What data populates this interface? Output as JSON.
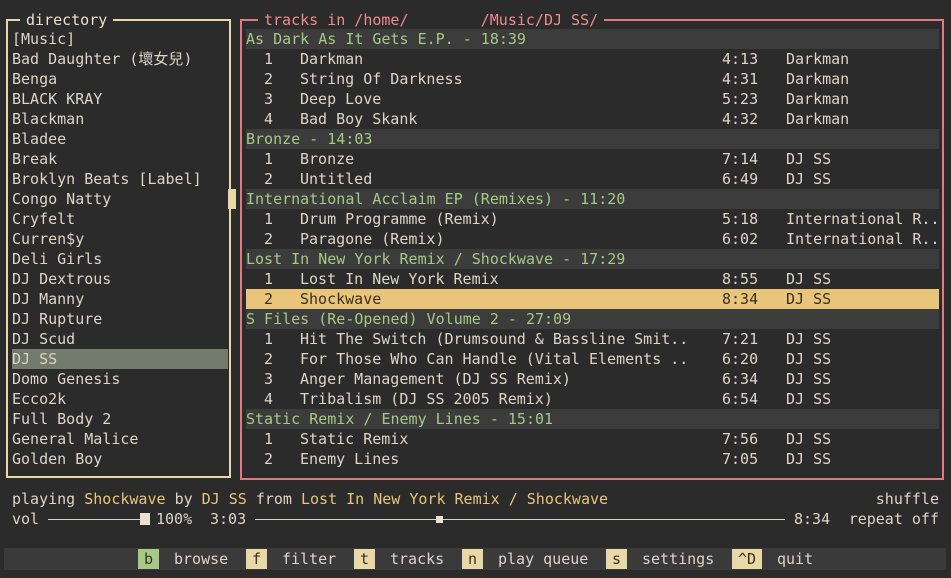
{
  "directory": {
    "title": "directory",
    "items": [
      "[Music]",
      "Bad Daughter (壞女兒)",
      "Benga",
      "BLACK KRAY",
      "Blackman",
      "Bladee",
      "Break",
      "Broklyn Beats [Label]",
      "Congo Natty",
      "Cryfelt",
      "Curren$y",
      "Deli Girls",
      "DJ Dextrous",
      "DJ Manny",
      "DJ Rupture",
      "DJ Scud",
      "DJ SS",
      "Domo Genesis",
      "Ecco2k",
      "Full Body 2",
      "General Malice",
      "Golden Boy"
    ],
    "selected_index": 16
  },
  "tracks_panel": {
    "title": "tracks in /home/        /Music/DJ SS/",
    "albums": [
      {
        "header": "As Dark As It Gets E.P. - 18:39",
        "tracks": [
          {
            "num": "1",
            "title": "Darkman",
            "duration": "4:13",
            "artist": "Darkman"
          },
          {
            "num": "2",
            "title": "String Of Darkness",
            "duration": "4:31",
            "artist": "Darkman"
          },
          {
            "num": "3",
            "title": "Deep Love",
            "duration": "5:23",
            "artist": "Darkman"
          },
          {
            "num": "4",
            "title": "Bad Boy Skank",
            "duration": "4:32",
            "artist": "Darkman"
          }
        ]
      },
      {
        "header": "Bronze - 14:03",
        "tracks": [
          {
            "num": "1",
            "title": "Bronze",
            "duration": "7:14",
            "artist": "DJ SS"
          },
          {
            "num": "2",
            "title": "Untitled",
            "duration": "6:49",
            "artist": "DJ SS"
          }
        ]
      },
      {
        "header": "International Acclaim EP (Remixes) - 11:20",
        "tracks": [
          {
            "num": "1",
            "title": "Drum Programme (Remix)",
            "duration": "5:18",
            "artist": "International R.."
          },
          {
            "num": "2",
            "title": "Paragone (Remix)",
            "duration": "6:02",
            "artist": "International R.."
          }
        ]
      },
      {
        "header": "Lost In New York Remix / Shockwave - 17:29",
        "tracks": [
          {
            "num": "1",
            "title": "Lost In New York Remix",
            "duration": "8:55",
            "artist": "DJ SS"
          },
          {
            "num": "2",
            "title": "Shockwave",
            "duration": "8:34",
            "artist": "DJ SS",
            "selected": true
          }
        ]
      },
      {
        "header": "S Files (Re-Opened) Volume 2 - 27:09",
        "tracks": [
          {
            "num": "1",
            "title": "Hit The Switch (Drumsound & Bassline Smit..",
            "duration": "7:21",
            "artist": "DJ SS"
          },
          {
            "num": "2",
            "title": "For Those Who Can Handle (Vital Elements ..",
            "duration": "6:20",
            "artist": "DJ SS"
          },
          {
            "num": "3",
            "title": "Anger Management (DJ SS Remix)",
            "duration": "6:34",
            "artist": "DJ SS"
          },
          {
            "num": "4",
            "title": "Tribalism (DJ SS 2005 Remix)",
            "duration": "6:54",
            "artist": "DJ SS"
          }
        ]
      },
      {
        "header": "Static Remix / Enemy Lines - 15:01",
        "tracks": [
          {
            "num": "1",
            "title": "Static Remix",
            "duration": "7:56",
            "artist": "DJ SS"
          },
          {
            "num": "2",
            "title": "Enemy Lines",
            "duration": "7:05",
            "artist": "DJ SS"
          }
        ]
      }
    ]
  },
  "status": {
    "playing_word": "playing",
    "track": "Shockwave",
    "by_word": "by",
    "artist": "DJ SS",
    "from_word": "from",
    "album": "Lost In New York Remix / Shockwave",
    "shuffle": "shuffle",
    "repeat": "repeat off",
    "vol_label": "vol",
    "volume": "100%",
    "volume_fraction": 1.0,
    "elapsed": "3:03",
    "total": "8:34",
    "progress_fraction": 0.356
  },
  "keybar": [
    {
      "key": "b",
      "label": "browse",
      "active": true
    },
    {
      "key": "f",
      "label": "filter"
    },
    {
      "key": "t",
      "label": "tracks"
    },
    {
      "key": "n",
      "label": "play queue"
    },
    {
      "key": "s",
      "label": "settings"
    },
    {
      "key": "^D",
      "label": "quit"
    }
  ],
  "colors": {
    "background": "#2b2b2b",
    "directory_border": "#e8d9a6",
    "tracks_border": "#e07a7f",
    "album_header": "#a6c986",
    "selected_track": "#e8c57a",
    "selected_dir": "#737b6f"
  }
}
